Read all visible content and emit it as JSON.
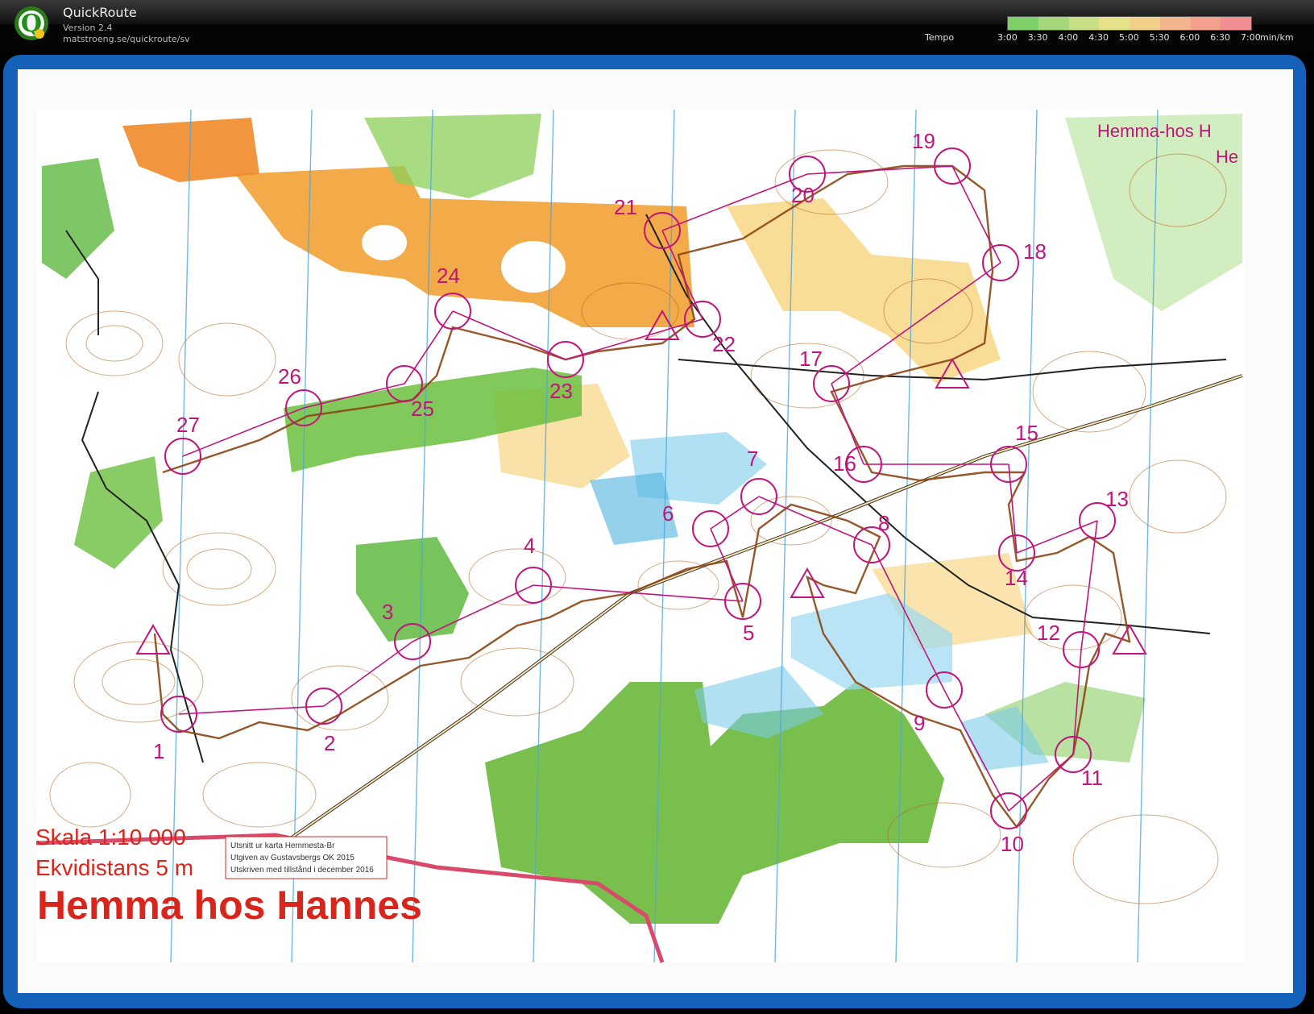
{
  "app": {
    "title": "QuickRoute",
    "version": "Version 2.4",
    "url": "matstroeng.se/quickroute/sv"
  },
  "pace_legend": {
    "label": "Tempo",
    "ticks": [
      "3:00",
      "3:30",
      "4:00",
      "4:30",
      "5:00",
      "5:30",
      "6:00",
      "6:30",
      "7:00"
    ],
    "unit": "min/km",
    "gradient_colors": [
      "#7fcf6a",
      "#a6d77a",
      "#c9df86",
      "#e6e28a",
      "#f1d08a",
      "#f2b48c",
      "#f3a08f",
      "#f08e92"
    ]
  },
  "map": {
    "title": "Hemma hos Hannes",
    "scale": "Skala 1:10 000",
    "contour_interval": "Ekvidistans 5 m",
    "credits": [
      "Utsnitt ur karta Hemmesta-Br",
      "Utgiven av Gustavsbergs OK 2015",
      "Utskriven med tillstånd i december 2016"
    ],
    "header_text_1": "Hemma-hos H",
    "header_text_2": "He",
    "colors": {
      "course": "#c0157a",
      "route": "#7a3a1a",
      "forest_green": "#6cbf3e",
      "open_orange": "#f2a33a",
      "water_blue": "#5fb7e2",
      "title_red": "#d9261c"
    },
    "controls": [
      {
        "label": "1"
      },
      {
        "label": "2"
      },
      {
        "label": "3"
      },
      {
        "label": "4"
      },
      {
        "label": "5"
      },
      {
        "label": "6"
      },
      {
        "label": "7"
      },
      {
        "label": "8"
      },
      {
        "label": "9"
      },
      {
        "label": "10"
      },
      {
        "label": "11"
      },
      {
        "label": "12"
      },
      {
        "label": "13"
      },
      {
        "label": "14"
      },
      {
        "label": "15"
      },
      {
        "label": "16"
      },
      {
        "label": "17"
      },
      {
        "label": "18"
      },
      {
        "label": "19"
      },
      {
        "label": "20"
      },
      {
        "label": "21"
      },
      {
        "label": "22"
      },
      {
        "label": "23"
      },
      {
        "label": "24"
      },
      {
        "label": "25"
      },
      {
        "label": "26"
      },
      {
        "label": "27"
      }
    ]
  }
}
